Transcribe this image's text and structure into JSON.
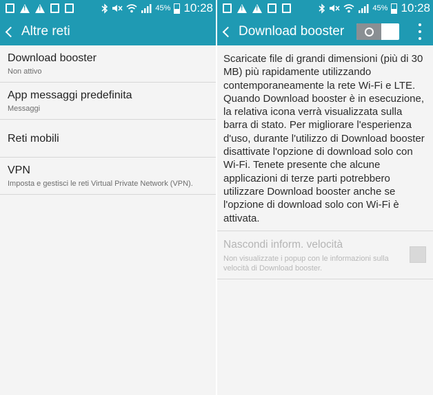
{
  "status_bar": {
    "battery_percent": "45%",
    "time": "10:28",
    "left_icons": [
      "image-icon",
      "warning-icon",
      "warning-icon",
      "image-icon",
      "calendar-icon"
    ],
    "right_icons": [
      "bluetooth-icon",
      "mute-icon",
      "wifi-icon",
      "signal-icon",
      "battery-icon"
    ]
  },
  "left_panel": {
    "title": "Altre reti",
    "items": [
      {
        "title": "Download booster",
        "subtitle": "Non attivo"
      },
      {
        "title": "App messaggi predefinita",
        "subtitle": "Messaggi"
      },
      {
        "title": "Reti mobili",
        "subtitle": ""
      },
      {
        "title": "VPN",
        "subtitle": "Imposta e gestisci le reti Virtual Private Network (VPN)."
      }
    ]
  },
  "right_panel": {
    "title": "Download booster",
    "toggle_on": false,
    "description": "Scaricate file di grandi dimensioni (più di 30 MB) più rapidamente utilizzando contemporaneamente la rete Wi-Fi e LTE. Quando Download booster è in esecuzione, la relativa icona verrà visualizzata sulla barra di stato. Per migliorare l'esperienza d'uso, durante l'utilizzo di Download booster disattivate l'opzione di download solo con Wi-Fi. Tenete presente che alcune applicazioni di terze parti potrebbero utilizzare Download booster anche se l'opzione di download solo con Wi-Fi è attivata.",
    "setting": {
      "title": "Nascondi inform. velocità",
      "subtitle": "Non visualizzate i popup con le informazioni sulla velocità di Download booster.",
      "checked": false,
      "enabled": false
    }
  },
  "colors": {
    "accent": "#1f9ab3",
    "background": "#f4f4f4",
    "divider": "#d7d7d7",
    "disabled_text": "#b5b5b5"
  }
}
